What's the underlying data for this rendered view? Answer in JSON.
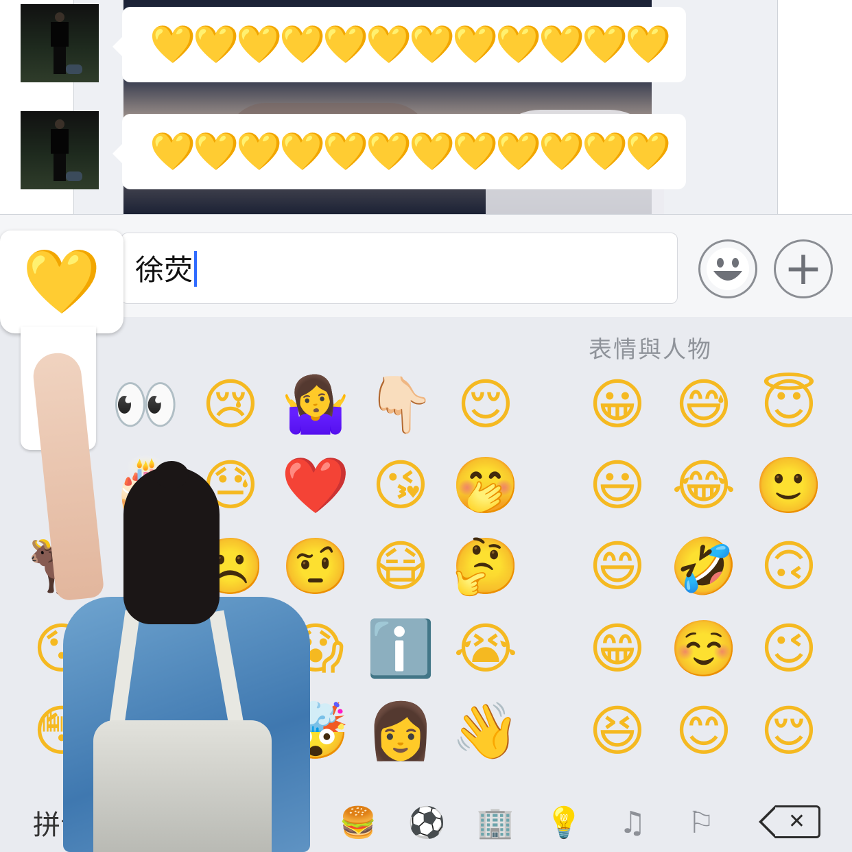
{
  "chat": {
    "messages": [
      {
        "sender": "avatar",
        "text": [
          "💛",
          "💛",
          "💛",
          "💛",
          "💛",
          "💛",
          "💛",
          "💛",
          "💛",
          "💛",
          "💛",
          "💛"
        ]
      },
      {
        "sender": "avatar",
        "text": [
          "💛",
          "💛",
          "💛",
          "💛",
          "💛",
          "💛",
          "💛",
          "💛",
          "💛",
          "💛",
          "💛",
          "💛"
        ]
      }
    ]
  },
  "input": {
    "value": "徐荧",
    "emoji_button_icon": "smiley-face-icon",
    "plus_button_label": "+"
  },
  "keyboard": {
    "popup_emoji": "💛",
    "category_title": "表情與人物",
    "left_emojis": [
      [
        "👀",
        "😢",
        "🤷‍♀️",
        "👇🏻",
        "😌"
      ],
      [
        "🎂",
        "😓",
        "❤️",
        "😘",
        "🤭"
      ],
      [
        "🐂",
        "☹️",
        "🤨",
        "😷",
        "🤔"
      ],
      [
        "😯",
        "😱",
        "ℹ️",
        "😭"
      ],
      [
        "😳",
        "🤯",
        "👩",
        "👋"
      ]
    ],
    "right_emojis": [
      [
        "😀",
        "😅",
        "😇"
      ],
      [
        "😃",
        "😂",
        "🙂"
      ],
      [
        "😄",
        "🤣",
        "🙃"
      ],
      [
        "😁",
        "☺️",
        "😉"
      ],
      [
        "😆",
        "😊",
        "😌"
      ]
    ],
    "toolbar": {
      "pinyin_label": "拼音",
      "icons": [
        {
          "name": "food-drink-icon",
          "glyph": "🍔"
        },
        {
          "name": "activity-ball-icon",
          "glyph": "⚽"
        },
        {
          "name": "travel-places-icon",
          "glyph": "🏢"
        },
        {
          "name": "objects-bulb-icon",
          "glyph": "💡"
        },
        {
          "name": "symbols-icon",
          "glyph": "♫"
        },
        {
          "name": "flags-icon",
          "glyph": "⚐"
        }
      ],
      "delete_label": "✕"
    }
  },
  "colors": {
    "keyboard_bg": "#e9ebf0",
    "caret": "#2f6bff",
    "heart": "#f6c21c"
  }
}
